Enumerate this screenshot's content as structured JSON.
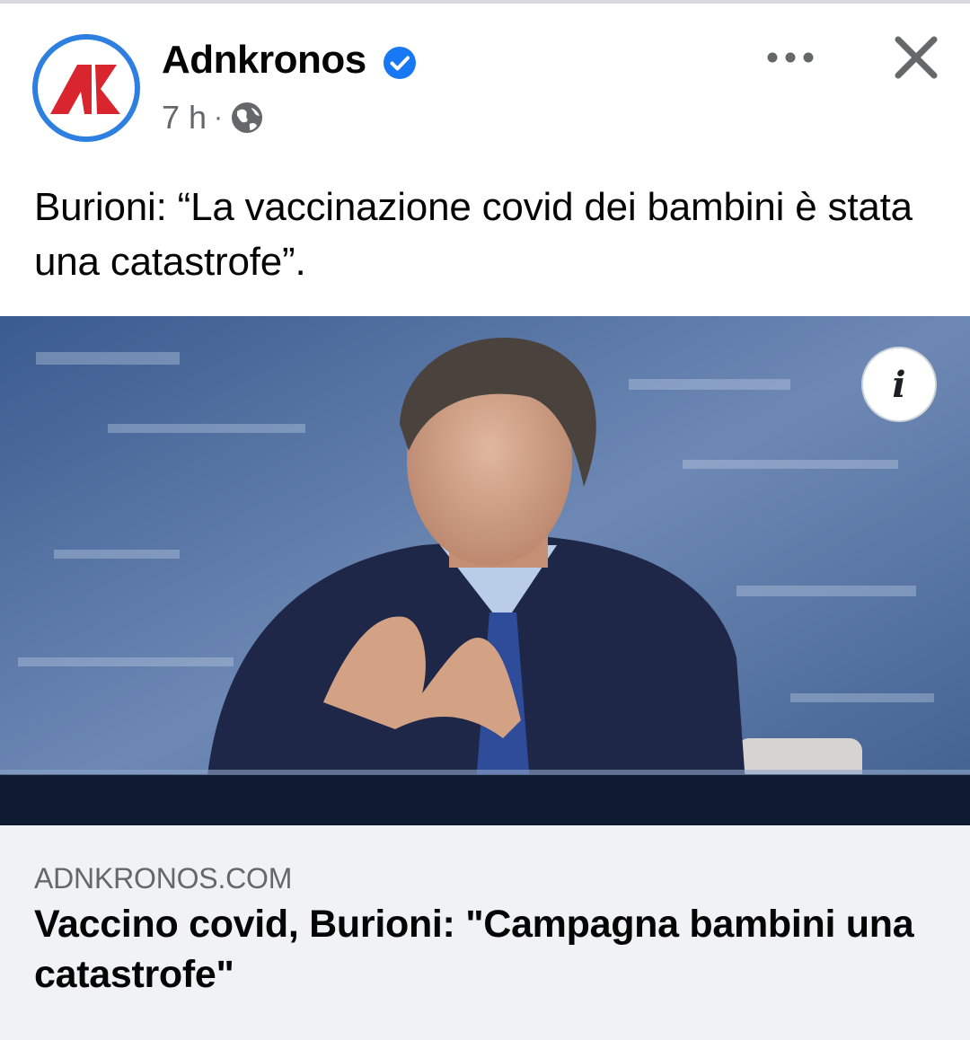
{
  "post": {
    "page_name": "Adnkronos",
    "timestamp": "7 h",
    "separator": "·",
    "audience_icon": "globe-icon",
    "verified_icon": "verified-badge-icon",
    "text": "Burioni: “La vaccinazione covid dei bambini è stata una catastrofe”."
  },
  "header_actions": {
    "more_icon": "more-dots-icon",
    "close_icon": "close-icon"
  },
  "photo": {
    "info_glyph": "i",
    "info_icon": "info-icon"
  },
  "link": {
    "domain": "ADNKRONOS.COM",
    "title": "Vaccino covid, Burioni: \"Campagna bambini una catastrofe\""
  },
  "colors": {
    "accent_blue": "#2d7fe0",
    "logo_red": "#d9262e",
    "link_card_bg": "#f0f2f5",
    "secondary_text": "#65676b"
  }
}
